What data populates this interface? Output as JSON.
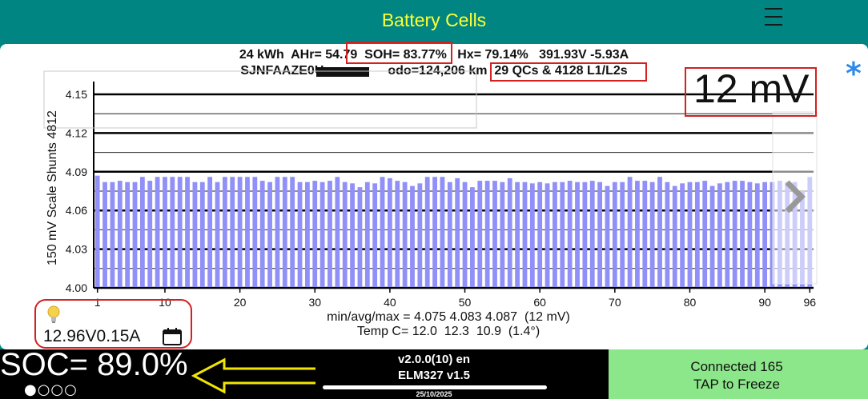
{
  "header": {
    "title": "Battery Cells"
  },
  "info": {
    "line1": "24 kWh  AHr= 54.79  SOH= 83.77%   Hx= 79.14%   391.93V -5.93A",
    "line2": "SJNFAAZE0U                  odo=124,206 km  29 QCs & 4128 L1/L2s"
  },
  "scale_label": "12 mV",
  "star": "*",
  "chart_data": {
    "type": "bar",
    "ylabel": "150 mV Scale   Shunts 4812",
    "ylim": [
      4.0,
      4.15
    ],
    "yticks": [
      "4.00",
      "4.03",
      "4.06",
      "4.09",
      "4.12",
      "4.15"
    ],
    "xticks": [
      "1",
      "10",
      "20",
      "30",
      "40",
      "50",
      "60",
      "70",
      "80",
      "90",
      "96"
    ],
    "grid": true,
    "bar_color": "#9090f8",
    "cells": [
      1,
      2,
      3,
      4,
      5,
      6,
      7,
      8,
      9,
      10,
      11,
      12,
      13,
      14,
      15,
      16,
      17,
      18,
      19,
      20,
      21,
      22,
      23,
      24,
      25,
      26,
      27,
      28,
      29,
      30,
      31,
      32,
      33,
      34,
      35,
      36,
      37,
      38,
      39,
      40,
      41,
      42,
      43,
      44,
      45,
      46,
      47,
      48,
      49,
      50,
      51,
      52,
      53,
      54,
      55,
      56,
      57,
      58,
      59,
      60,
      61,
      62,
      63,
      64,
      65,
      66,
      67,
      68,
      69,
      70,
      71,
      72,
      73,
      74,
      75,
      76,
      77,
      78,
      79,
      80,
      81,
      82,
      83,
      84,
      85,
      86,
      87,
      88,
      89,
      90,
      91,
      92,
      93,
      94,
      95,
      96
    ],
    "values": [
      4.087,
      4.082,
      4.082,
      4.083,
      4.082,
      4.082,
      4.086,
      4.083,
      4.086,
      4.086,
      4.086,
      4.086,
      4.086,
      4.082,
      4.082,
      4.086,
      4.082,
      4.086,
      4.086,
      4.086,
      4.086,
      4.086,
      4.083,
      4.082,
      4.086,
      4.086,
      4.086,
      4.082,
      4.082,
      4.083,
      4.082,
      4.083,
      4.086,
      4.082,
      4.081,
      4.078,
      4.082,
      4.081,
      4.086,
      4.085,
      4.083,
      4.082,
      4.079,
      4.081,
      4.086,
      4.086,
      4.086,
      4.082,
      4.085,
      4.082,
      4.078,
      4.083,
      4.083,
      4.083,
      4.082,
      4.085,
      4.082,
      4.082,
      4.081,
      4.082,
      4.081,
      4.082,
      4.082,
      4.083,
      4.082,
      4.082,
      4.083,
      4.082,
      4.079,
      4.082,
      4.082,
      4.086,
      4.083,
      4.083,
      4.082,
      4.086,
      4.082,
      4.079,
      4.081,
      4.082,
      4.082,
      4.083,
      4.079,
      4.081,
      4.082,
      4.083,
      4.083,
      4.082,
      4.081,
      4.082,
      4.082,
      4.083,
      4.082,
      4.082,
      4.075,
      4.086
    ]
  },
  "stats": {
    "minavgmax": "min/avg/max = 4.075 4.083 4.087  (12 mV)",
    "temp": "Temp C= 12.0  12.3  10.9  (1.4°)"
  },
  "aux": {
    "voltage": "12.96V0.15A"
  },
  "soc": {
    "text": "SOC= 89.0%",
    "dots": "●○○○"
  },
  "version": {
    "line1": "v2.0.0(10) en",
    "line2": "ELM327 v1.5",
    "date": "25/10/2025"
  },
  "connection": {
    "status": "Connected 165",
    "action": "TAP to Freeze"
  },
  "colors": {
    "header_bg": "#008583",
    "title": "#ffff33",
    "highlight": "#d32020",
    "accent": "#2d8ae8",
    "connect_bg": "#8ce68a"
  }
}
